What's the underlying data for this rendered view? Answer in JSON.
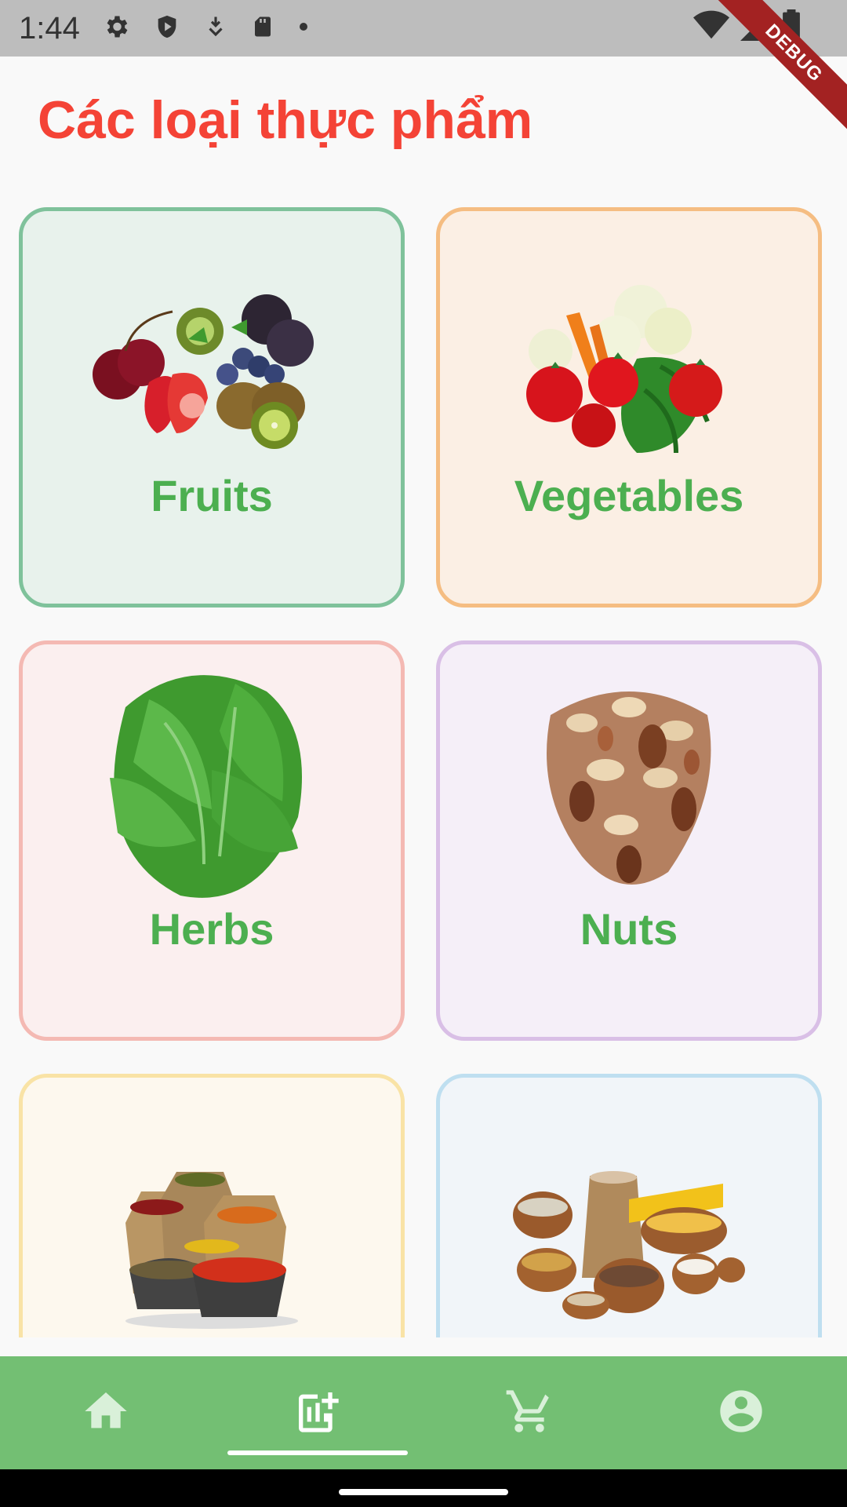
{
  "status_bar": {
    "time": "1:44",
    "icons": [
      "gear-icon",
      "shield-icon",
      "download-icon",
      "sd-card-icon",
      "dot-icon",
      "wifi-icon",
      "signal-icon",
      "battery-icon"
    ],
    "debug_label": "DEBUG"
  },
  "title": "Các loại thực phẩm",
  "categories": [
    {
      "label": "Fruits",
      "bg": "#e8f2ec",
      "border": "#7fc29b"
    },
    {
      "label": "Vegetables",
      "bg": "#fbefe4",
      "border": "#f5bd82"
    },
    {
      "label": "Herbs",
      "bg": "#fbefef",
      "border": "#f4b9b3"
    },
    {
      "label": "Nuts",
      "bg": "#f5eff8",
      "border": "#d9bfe6"
    },
    {
      "label": "",
      "bg": "#fdf8ee",
      "border": "#f9e3a6"
    },
    {
      "label": "",
      "bg": "#f1f5f9",
      "border": "#bfdff0"
    }
  ],
  "bottom_nav": {
    "items": [
      "home-icon",
      "add-chart-icon",
      "cart-icon",
      "account-icon"
    ],
    "selected_index": 1,
    "color": "#73bf73"
  },
  "colors": {
    "title": "#f44336",
    "label": "#4caf50"
  }
}
